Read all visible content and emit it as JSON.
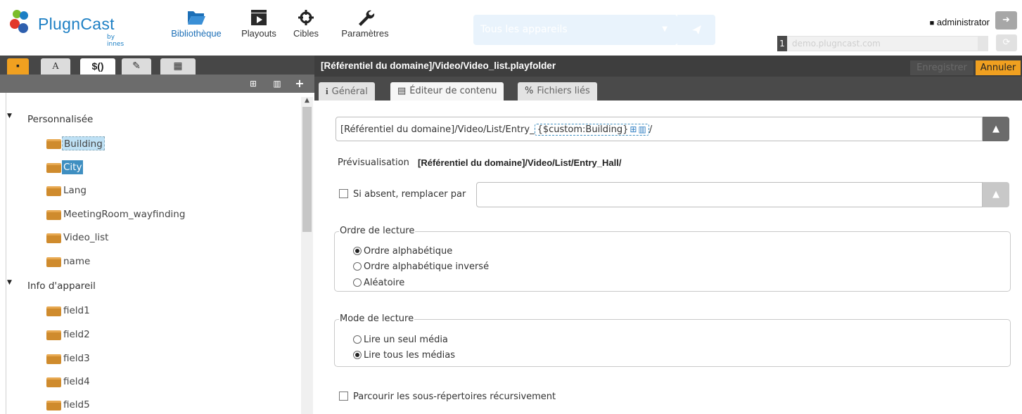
{
  "app": {
    "logo_text": "PlugnCast",
    "logo_sub": "by innes"
  },
  "nav": [
    {
      "label": "Bibliothèque",
      "icon": "folder-open-icon",
      "active": true
    },
    {
      "label": "Playouts",
      "icon": "film-icon"
    },
    {
      "label": "Cibles",
      "icon": "crosshairs-icon"
    },
    {
      "label": "Paramètres",
      "icon": "wrench-icon"
    }
  ],
  "device_select": {
    "placeholder": "Tous les appareils"
  },
  "user": {
    "name": "administrator"
  },
  "domain": {
    "index": "1",
    "value": "demo.plugncast.com"
  },
  "left": {
    "tabs": [
      {
        "label": "",
        "icon": "archive-icon"
      },
      {
        "label": "A"
      },
      {
        "label": "$()",
        "active": true
      },
      {
        "label": "",
        "icon": "tag-icon"
      },
      {
        "label": "",
        "icon": "calendar-icon"
      }
    ],
    "groups": [
      {
        "label": "Personnalisée",
        "items": [
          "Building",
          "City",
          "Lang",
          "MeetingRoom_wayfinding",
          "Video_list",
          "name"
        ]
      },
      {
        "label": "Info d'appareil",
        "items": [
          "field1",
          "field2",
          "field3",
          "field4",
          "field5"
        ]
      }
    ]
  },
  "editor": {
    "title": "[Référentiel du domaine]/Video/Video_list.playfolder",
    "save_label": "Enregistrer",
    "cancel_label": "Annuler",
    "tabs": {
      "general": "Général",
      "content_editor": "Éditeur de contenu",
      "linked_files": "Fichiers liés"
    },
    "path_prefix": "[Référentiel du domaine]/Video/List/Entry_",
    "path_chip": "{$custom:Building}",
    "path_suffix": "/",
    "preview_label": "Prévisualisation",
    "preview_value": "[Référentiel du domaine]/Video/List/Entry_Hall/",
    "if_absent_label": "Si absent, remplacer par",
    "if_absent_value": "",
    "order_legend": "Ordre de lecture",
    "order_options": [
      "Ordre alphabétique",
      "Ordre alphabétique inversé",
      "Aléatoire"
    ],
    "order_selected": 0,
    "mode_legend": "Mode de lecture",
    "mode_options": [
      "Lire un seul média",
      "Lire tous les médias"
    ],
    "mode_selected": 1,
    "recursive_label": "Parcourir les sous-répertoires récursivement",
    "recursive_checked": false
  },
  "colors": {
    "accent": "#1c7fc4",
    "cancel": "#f0a020",
    "selected": "#3f8fc1",
    "folder": "#cf8b2d"
  }
}
